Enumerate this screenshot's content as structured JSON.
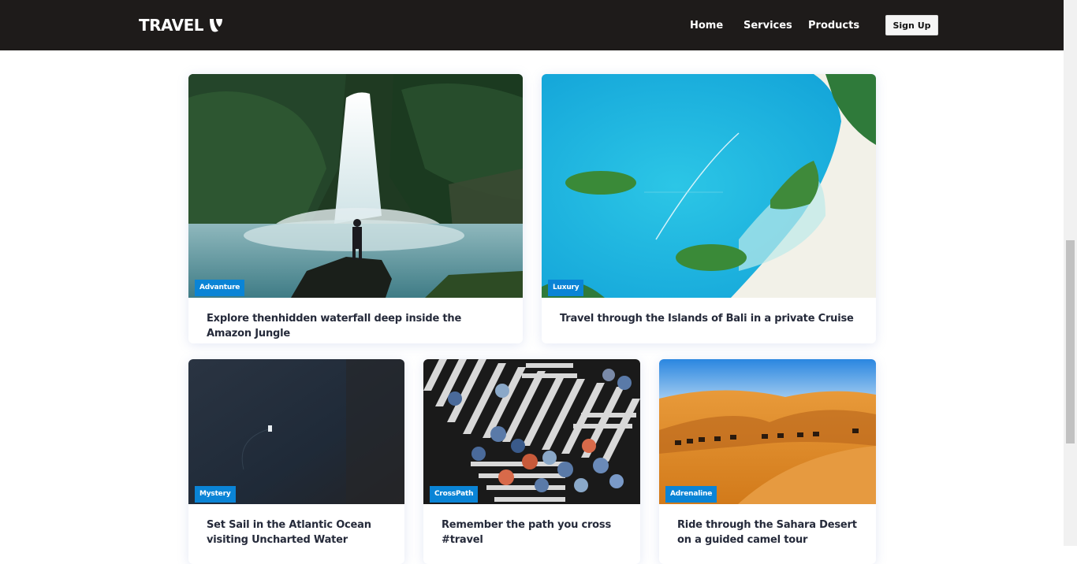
{
  "header": {
    "brand": "TRAVEL",
    "logo_icon": "typo3-logo-icon",
    "nav": {
      "home": "Home",
      "services": "Services",
      "products": "Products"
    },
    "signup_label": "Sign Up"
  },
  "colors": {
    "navbar_bg": "#1e1b1a",
    "badge_bg": "#0a84d6",
    "title_text": "#252a3a"
  },
  "cards": [
    {
      "category": "Advanture",
      "title": "Explore thenhidden waterfall deep inside the Amazon Jungle",
      "image": "waterfall-photo"
    },
    {
      "category": "Luxury",
      "title": "Travel through the Islands of Bali in a private Cruise",
      "image": "island-aerial-photo"
    },
    {
      "category": "Mystery",
      "title": "Set Sail in the Atlantic Ocean visiting Uncharted Water",
      "image": "ocean-boat-photo"
    },
    {
      "category": "CrossPath",
      "title": "Remember the path you cross #travel",
      "image": "crosswalk-umbrellas-photo"
    },
    {
      "category": "Adrenaline",
      "title": "Ride through the Sahara Desert on a guided camel tour",
      "image": "desert-camels-photo"
    }
  ]
}
